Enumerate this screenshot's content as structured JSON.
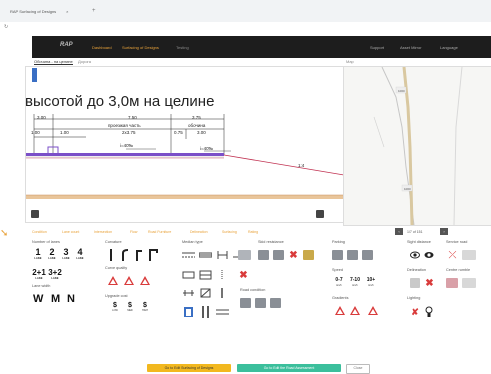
{
  "browser": {
    "tab_title": "RAP Surfacing of Designs",
    "tab_close": "×",
    "new_tab": "+"
  },
  "nav": {
    "logo": "RAP",
    "links": [
      "Dashboard",
      "Surfacing of Designs",
      "Testing"
    ],
    "right": [
      "Support",
      "Asset Mirror",
      "Language"
    ]
  },
  "content_tabs": {
    "tab1": "Обочина - на целине",
    "tab2": "Дорога",
    "map": "Map"
  },
  "drawing": {
    "title": "высотой до 3,0м на целине",
    "dims": {
      "d1": "3.00",
      "d2": "7.50",
      "d3": "3.75",
      "carriageway": "проезжая часть",
      "shoulder": "обочина",
      "lanes": "2x3.75",
      "d4": "1.00",
      "d5": "1.00",
      "d6": "0.75",
      "d7": "3.00",
      "slope1": "i=40‰",
      "slope2": "i=40‰",
      "slope3": "1:4"
    }
  },
  "map": {
    "label1": "1000",
    "label2": "1000"
  },
  "legend": {
    "items": [
      "Condition",
      "Lane count",
      "Intersection",
      "Flow",
      "Road Furniture",
      "Delineation",
      "Surfacing",
      "Rating"
    ],
    "pager_label": "1/7 of 151",
    "prev": "‹",
    "next": "›"
  },
  "groups": {
    "lanes": {
      "title": "Number of lanes",
      "items": [
        "1",
        "2",
        "3",
        "4"
      ],
      "sub": "LANE",
      "combo": [
        "2+1",
        "3+2"
      ],
      "combo_sub": "LANE",
      "lane_width_title": "Lane width",
      "wmn": [
        "W",
        "M",
        "N"
      ]
    },
    "curvature": {
      "title": "Curvature",
      "quality_title": "Curve quality",
      "grade_title": "Upgrade cost",
      "grades": [
        {
          "value": "$",
          "label": "LOW"
        },
        {
          "value": "$",
          "label": "MED"
        },
        {
          "value": "$",
          "label": "HIGH"
        }
      ]
    },
    "median": {
      "title": "Median type",
      "road_cond_title": "Road condition"
    },
    "skid": {
      "title": "Skid resistance"
    },
    "parking": {
      "title": "Parking",
      "speed_title": "Speed",
      "speeds": [
        "0-7",
        "7-10",
        "10+"
      ],
      "speed_unit": "km/h",
      "shoulder_title": "Gradients"
    },
    "sight": {
      "title": "Sight distance",
      "services_title": "Service road",
      "delineation_title": "Delineation",
      "centre_title": "Centre rumble",
      "lighting_title": "Lighting"
    }
  },
  "bottom": {
    "btn1": "Go to Edit Surfacing of Designs",
    "btn2": "Go to Edit the Road Assessment",
    "btn3": "Close"
  },
  "colors": {
    "accent": "#e8a23a",
    "nav_bg": "#1d1d1d",
    "purple": "#7b4fc8",
    "btn_yellow": "#f2b81f",
    "btn_green": "#3bbf9c"
  }
}
